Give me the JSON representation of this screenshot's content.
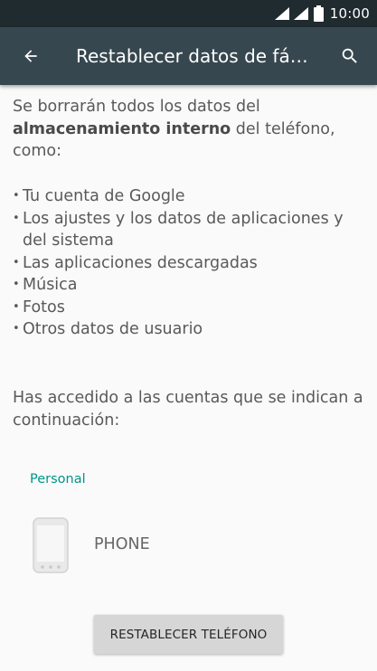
{
  "status_bar": {
    "time": "10:00",
    "icons": [
      "wifi-icon",
      "signal-icon",
      "battery-icon"
    ]
  },
  "app_bar": {
    "title": "Restablecer datos de fá…",
    "back_icon": "arrow-back-icon",
    "search_icon": "search-icon"
  },
  "content": {
    "intro_start": "Se borrarán todos los datos del ",
    "intro_bold": "almacenamiento interno",
    "intro_end": " del teléfono, como:",
    "items": [
      "Tu cuenta de Google",
      "Los ajustes y los datos de aplicaciones y del sistema",
      "Las aplicaciones descargadas",
      "Música",
      "Fotos",
      "Otros datos de usuario"
    ],
    "accounts_intro": "Has accedido a las cuentas que se indican a continuación:"
  },
  "accounts": {
    "section_header": "Personal",
    "items": [
      {
        "label": "PHONE",
        "icon": "phone-icon"
      }
    ]
  },
  "reset_button": {
    "label": "RESTABLECER TELÉFONO"
  },
  "colors": {
    "status_bar": "#202b30",
    "app_bar": "#37474f",
    "accent": "#009587",
    "background": "#fafafa",
    "body_text": "#595959",
    "button": "#d6d6d6"
  }
}
